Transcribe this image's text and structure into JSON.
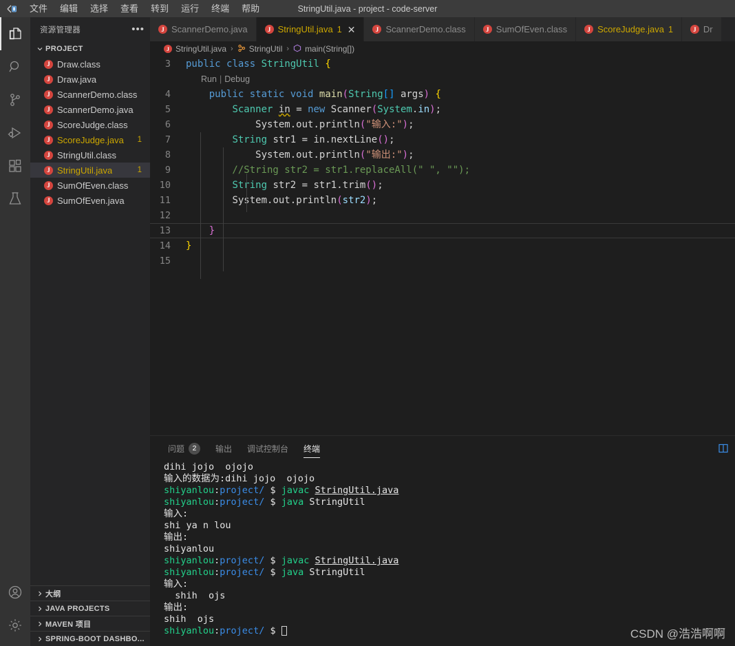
{
  "titlebar": {
    "logo_icon": "code-server-logo-icon",
    "title": "StringUtil.java - project - code-server",
    "menu": [
      {
        "label": "文件"
      },
      {
        "label": "编辑"
      },
      {
        "label": "选择"
      },
      {
        "label": "查看"
      },
      {
        "label": "转到"
      },
      {
        "label": "运行"
      },
      {
        "label": "终端"
      },
      {
        "label": "帮助"
      }
    ]
  },
  "activitybar": {
    "top": [
      {
        "name": "explorer",
        "icon": "files-icon",
        "active": true
      },
      {
        "name": "search",
        "icon": "search-icon",
        "active": false
      },
      {
        "name": "source-control",
        "icon": "source-control-icon",
        "active": false
      },
      {
        "name": "run-debug",
        "icon": "run-and-debug-icon",
        "active": false
      },
      {
        "name": "extensions",
        "icon": "extensions-icon",
        "active": false
      },
      {
        "name": "testing",
        "icon": "beaker-icon",
        "active": false
      }
    ],
    "bottom": [
      {
        "name": "accounts",
        "icon": "account-icon"
      },
      {
        "name": "manage",
        "icon": "gear-icon"
      }
    ]
  },
  "sidebar": {
    "header_title": "资源管理器",
    "more_actions_icon": "ellipsis-icon",
    "project": {
      "label": "PROJECT",
      "expanded": true,
      "files": [
        {
          "name": "Draw.class",
          "warn": false,
          "count": ""
        },
        {
          "name": "Draw.java",
          "warn": false,
          "count": ""
        },
        {
          "name": "ScannerDemo.class",
          "warn": false,
          "count": ""
        },
        {
          "name": "ScannerDemo.java",
          "warn": false,
          "count": ""
        },
        {
          "name": "ScoreJudge.class",
          "warn": false,
          "count": ""
        },
        {
          "name": "ScoreJudge.java",
          "warn": true,
          "count": "1"
        },
        {
          "name": "StringUtil.class",
          "warn": false,
          "count": ""
        },
        {
          "name": "StringUtil.java",
          "warn": true,
          "count": "1",
          "selected": true
        },
        {
          "name": "SumOfEven.class",
          "warn": false,
          "count": ""
        },
        {
          "name": "SumOfEven.java",
          "warn": false,
          "count": ""
        }
      ]
    },
    "sections": [
      {
        "label": "大纲"
      },
      {
        "label": "JAVA PROJECTS"
      },
      {
        "label": "MAVEN 项目"
      },
      {
        "label": "SPRING-BOOT DASHBO..."
      }
    ]
  },
  "tabs": [
    {
      "name": "ScannerDemo.java",
      "active": false,
      "warn": false,
      "count": "",
      "close": ""
    },
    {
      "name": "StringUtil.java",
      "active": true,
      "warn": true,
      "count": "1",
      "close": "✕"
    },
    {
      "name": "ScannerDemo.class",
      "active": false,
      "warn": false,
      "count": "",
      "close": ""
    },
    {
      "name": "SumOfEven.class",
      "active": false,
      "warn": false,
      "count": "",
      "close": ""
    },
    {
      "name": "ScoreJudge.java",
      "active": false,
      "warn": true,
      "count": "1",
      "close": ""
    },
    {
      "name": "Dr",
      "active": false,
      "warn": false,
      "count": "",
      "close": ""
    }
  ],
  "breadcrumbs": {
    "file": "StringUtil.java",
    "class": "StringUtil",
    "method": "main(String[])",
    "separator": "›"
  },
  "editor": {
    "codelens": {
      "run": "Run",
      "separator": "|",
      "debug": "Debug"
    },
    "lines": [
      {
        "no": "3",
        "text": "public class StringUtil {"
      },
      {
        "no": "4",
        "text": "    public static void main(String[] args) {"
      },
      {
        "no": "5",
        "text": "        Scanner in = new Scanner(System.in);"
      },
      {
        "no": "6",
        "text": "            System.out.println(\"输入:\");"
      },
      {
        "no": "7",
        "text": "        String str1 = in.nextLine();"
      },
      {
        "no": "8",
        "text": "            System.out.println(\"输出:\");"
      },
      {
        "no": "9",
        "text": "        //String str2 = str1.replaceAll(\" \", \"\");"
      },
      {
        "no": "10",
        "text": "        String str2 = str1.trim();"
      },
      {
        "no": "11",
        "text": "        System.out.println(str2);"
      },
      {
        "no": "12",
        "text": ""
      },
      {
        "no": "13",
        "text": "    }",
        "current": true
      },
      {
        "no": "14",
        "text": "}"
      },
      {
        "no": "15",
        "text": ""
      }
    ]
  },
  "panel": {
    "tabs": [
      {
        "label": "问题",
        "badge": "2",
        "active": false
      },
      {
        "label": "输出",
        "badge": "",
        "active": false
      },
      {
        "label": "调试控制台",
        "badge": "",
        "active": false
      },
      {
        "label": "终端",
        "badge": "",
        "active": true
      }
    ],
    "action_icon": "split-terminal-icon",
    "terminal_lines": [
      {
        "segments": [
          {
            "t": "dihi jojo  ojojo",
            "c": "t-white"
          }
        ]
      },
      {
        "segments": [
          {
            "t": "输入的数据为:dihi jojo  ojojo",
            "c": "t-white"
          }
        ]
      },
      {
        "segments": [
          {
            "t": "shiyanlou",
            "c": "t-green"
          },
          {
            "t": ":",
            "c": "t-white"
          },
          {
            "t": "project/",
            "c": "t-blue"
          },
          {
            "t": " $ ",
            "c": "t-white"
          },
          {
            "t": "javac ",
            "c": "t-green"
          },
          {
            "t": "StringUtil.java",
            "c": "t-white t-ul"
          }
        ]
      },
      {
        "segments": [
          {
            "t": "shiyanlou",
            "c": "t-green"
          },
          {
            "t": ":",
            "c": "t-white"
          },
          {
            "t": "project/",
            "c": "t-blue"
          },
          {
            "t": " $ ",
            "c": "t-white"
          },
          {
            "t": "java ",
            "c": "t-green"
          },
          {
            "t": "StringUtil",
            "c": "t-white"
          }
        ]
      },
      {
        "segments": [
          {
            "t": "输入:",
            "c": "t-white"
          }
        ]
      },
      {
        "segments": [
          {
            "t": "shi ya n lou",
            "c": "t-white"
          }
        ]
      },
      {
        "segments": [
          {
            "t": "输出:",
            "c": "t-white"
          }
        ]
      },
      {
        "segments": [
          {
            "t": "shiyanlou",
            "c": "t-white"
          }
        ]
      },
      {
        "segments": [
          {
            "t": "shiyanlou",
            "c": "t-green"
          },
          {
            "t": ":",
            "c": "t-white"
          },
          {
            "t": "project/",
            "c": "t-blue"
          },
          {
            "t": " $ ",
            "c": "t-white"
          },
          {
            "t": "javac ",
            "c": "t-green"
          },
          {
            "t": "StringUtil.java",
            "c": "t-white t-ul"
          }
        ]
      },
      {
        "segments": [
          {
            "t": "shiyanlou",
            "c": "t-green"
          },
          {
            "t": ":",
            "c": "t-white"
          },
          {
            "t": "project/",
            "c": "t-blue"
          },
          {
            "t": " $ ",
            "c": "t-white"
          },
          {
            "t": "java ",
            "c": "t-green"
          },
          {
            "t": "StringUtil",
            "c": "t-white"
          }
        ]
      },
      {
        "segments": [
          {
            "t": "输入:",
            "c": "t-white"
          }
        ]
      },
      {
        "segments": [
          {
            "t": "  shih  ojs",
            "c": "t-white"
          }
        ]
      },
      {
        "segments": [
          {
            "t": "输出:",
            "c": "t-white"
          }
        ]
      },
      {
        "segments": [
          {
            "t": "shih  ojs",
            "c": "t-white"
          }
        ]
      },
      {
        "segments": [
          {
            "t": "shiyanlou",
            "c": "t-green"
          },
          {
            "t": ":",
            "c": "t-white"
          },
          {
            "t": "project/",
            "c": "t-blue"
          },
          {
            "t": " $ ",
            "c": "t-white"
          }
        ],
        "cursor": true
      }
    ]
  },
  "watermark": {
    "text": "CSDN @浩浩啊啊"
  },
  "colors": {
    "accent": "#007acc",
    "warn": "#cca700",
    "java_icon": "#d4453e",
    "terminal_green": "#23d18b",
    "terminal_blue": "#3b8eea",
    "editor_bg": "#1e1e1e",
    "sidebar_bg": "#252526",
    "titlebar_bg": "#3c3c3c"
  }
}
